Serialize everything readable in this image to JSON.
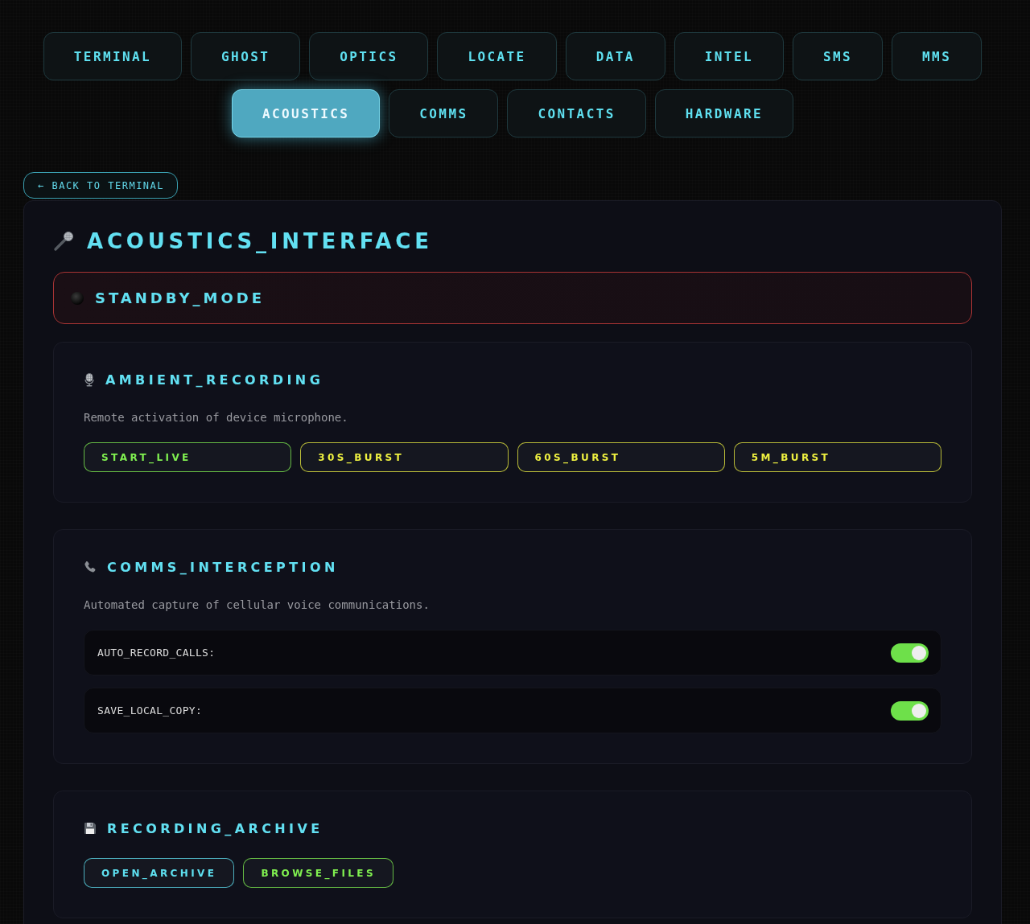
{
  "nav": {
    "tabs": [
      {
        "label": "TERMINAL",
        "selected": false
      },
      {
        "label": "GHOST",
        "selected": false
      },
      {
        "label": "OPTICS",
        "selected": false
      },
      {
        "label": "LOCATE",
        "selected": false
      },
      {
        "label": "DATA",
        "selected": false
      },
      {
        "label": "INTEL",
        "selected": false
      },
      {
        "label": "SMS",
        "selected": false
      },
      {
        "label": "MMS",
        "selected": false
      },
      {
        "label": "ACOUSTICS",
        "selected": true
      },
      {
        "label": "COMMS",
        "selected": false
      },
      {
        "label": "CONTACTS",
        "selected": false
      },
      {
        "label": "HARDWARE",
        "selected": false
      }
    ]
  },
  "back_button": {
    "label": "← BACK TO TERMINAL"
  },
  "panel": {
    "title": "ACOUSTICS_INTERFACE",
    "status": {
      "label": "STANDBY_MODE",
      "active": false
    },
    "sections": [
      {
        "kind": "ambient",
        "title": "AMBIENT_RECORDING",
        "description": "Remote activation of device microphone.",
        "buttons": [
          {
            "label": "START_LIVE",
            "color": "#80f050"
          },
          {
            "label": "30S_BURST",
            "color": "#eef040"
          },
          {
            "label": "60S_BURST",
            "color": "#eef040"
          },
          {
            "label": "5M_BURST",
            "color": "#eef040"
          }
        ]
      },
      {
        "kind": "intercept",
        "title": "COMMS_INTERCEPTION",
        "description": "Automated capture of cellular voice communications.",
        "toggles": [
          {
            "label": "AUTO_RECORD_CALLS:",
            "on": true
          },
          {
            "label": "SAVE_LOCAL_COPY:",
            "on": true
          }
        ]
      },
      {
        "kind": "archive",
        "title": "RECORDING_ARCHIVE",
        "buttons": [
          {
            "label": "OPEN_ARCHIVE",
            "color": "#5ee0f0"
          },
          {
            "label": "BROWSE_FILES",
            "color": "#80f050"
          }
        ]
      }
    ]
  }
}
